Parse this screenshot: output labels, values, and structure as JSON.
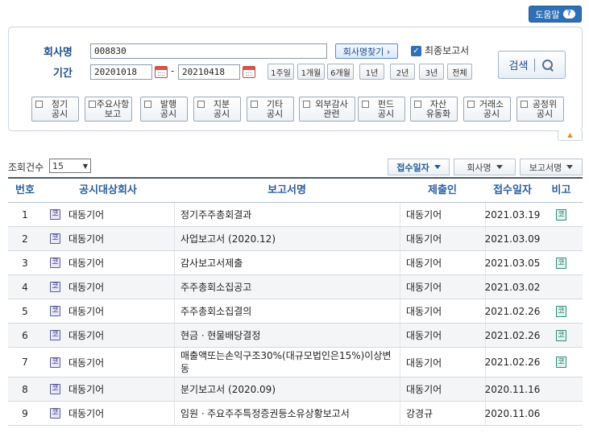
{
  "help": {
    "label": "도움말",
    "icon": "question-icon"
  },
  "search": {
    "company_label": "회사명",
    "company_value": "008830",
    "find_company_label": "회사명찾기 ›",
    "final_report_checked": true,
    "final_report_label": "최종보고서",
    "period_label": "기간",
    "start_date": "20201018",
    "date_sep": "-",
    "end_date": "20210418",
    "period_buttons": [
      "1주일",
      "1개월",
      "6개월",
      "1년",
      "2년",
      "3년",
      "전체"
    ],
    "search_label": "검색"
  },
  "disclosure_types": [
    {
      "line1": "정기",
      "line2": "공시"
    },
    {
      "line1": "주요사항",
      "line2": "보고"
    },
    {
      "line1": "발행",
      "line2": "공시"
    },
    {
      "line1": "지분",
      "line2": "공시"
    },
    {
      "line1": "기타",
      "line2": "공시"
    },
    {
      "line1": "외부감사",
      "line2": "관련"
    },
    {
      "line1": "펀드",
      "line2": "공시"
    },
    {
      "line1": "자산",
      "line2": "유동화"
    },
    {
      "line1": "거래소",
      "line2": "공시"
    },
    {
      "line1": "공정위",
      "line2": "공시"
    }
  ],
  "results": {
    "count_label": "조회건수",
    "count_value": "15",
    "sort_buttons": [
      "접수일자",
      "회사명",
      "보고서명"
    ],
    "headers": [
      "번호",
      "공시대상회사",
      "보고서명",
      "제출인",
      "접수일자",
      "비고"
    ],
    "badge_text": "코",
    "rows": [
      {
        "no": "1",
        "company": "대동기어",
        "report": "정기주주총회결과",
        "submitter": "대동기어",
        "date": "2021.03.19",
        "note": "코"
      },
      {
        "no": "2",
        "company": "대동기어",
        "report": "사업보고서 (2020.12)",
        "submitter": "대동기어",
        "date": "2021.03.09",
        "note": ""
      },
      {
        "no": "3",
        "company": "대동기어",
        "report": "감사보고서제출",
        "submitter": "대동기어",
        "date": "2021.03.05",
        "note": "코"
      },
      {
        "no": "4",
        "company": "대동기어",
        "report": "주주총회소집공고",
        "submitter": "대동기어",
        "date": "2021.03.02",
        "note": ""
      },
      {
        "no": "5",
        "company": "대동기어",
        "report": "주주총회소집결의",
        "submitter": "대동기어",
        "date": "2021.02.26",
        "note": "코"
      },
      {
        "no": "6",
        "company": "대동기어",
        "report": "현금ㆍ현물배당결정",
        "submitter": "대동기어",
        "date": "2021.02.26",
        "note": "코"
      },
      {
        "no": "7",
        "company": "대동기어",
        "report": "매출액또는손익구조30%(대규모법인은15%)이상변동",
        "submitter": "대동기어",
        "date": "2021.02.26",
        "note": "코"
      },
      {
        "no": "8",
        "company": "대동기어",
        "report": "분기보고서 (2020.09)",
        "submitter": "대동기어",
        "date": "2020.11.16",
        "note": ""
      },
      {
        "no": "9",
        "company": "대동기어",
        "report": "임원ㆍ주요주주특정증권등소유상황보고서",
        "submitter": "강경규",
        "date": "2020.11.06",
        "note": ""
      }
    ]
  }
}
